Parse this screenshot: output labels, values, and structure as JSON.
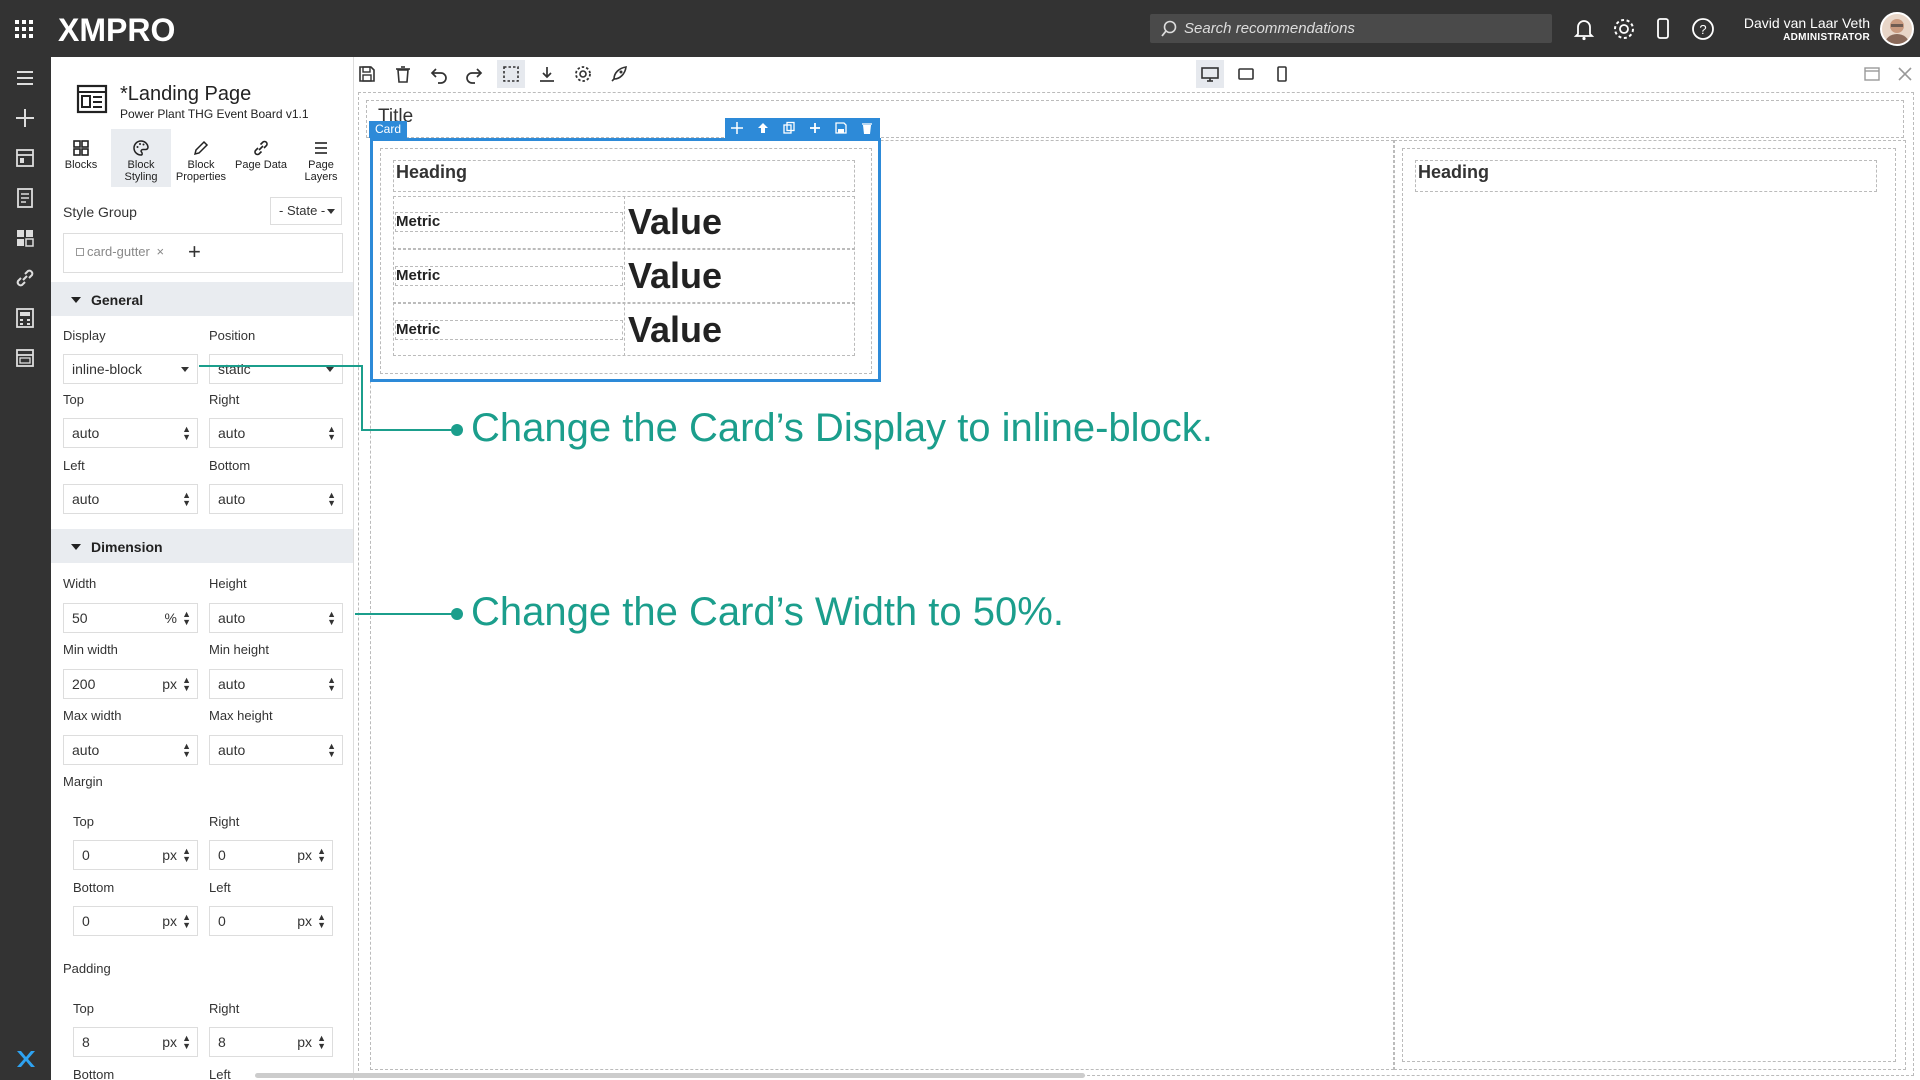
{
  "app": {
    "logo": "XMPRO",
    "search_placeholder": "Search recommendations",
    "user_name": "David van Laar Veth",
    "user_role": "ADMINISTRATOR"
  },
  "page": {
    "title": "*Landing Page",
    "subtitle": "Power Plant THG Event Board v1.1"
  },
  "tabs": [
    {
      "label": "Blocks"
    },
    {
      "label": "Block Styling"
    },
    {
      "label": "Block Properties"
    },
    {
      "label": "Page Data"
    },
    {
      "label": "Page Layers"
    }
  ],
  "style_group": {
    "label": "Style Group",
    "state": "- State -",
    "chip": "card-gutter"
  },
  "general": {
    "header": "General",
    "display_label": "Display",
    "display_value": "inline-block",
    "position_label": "Position",
    "position_value": "static",
    "top_label": "Top",
    "top_value": "auto",
    "right_label": "Right",
    "right_value": "auto",
    "left_label": "Left",
    "left_value": "auto",
    "bottom_label": "Bottom",
    "bottom_value": "auto"
  },
  "dimension": {
    "header": "Dimension",
    "width_label": "Width",
    "width_value": "50",
    "width_unit": "%",
    "height_label": "Height",
    "height_value": "auto",
    "min_width_label": "Min width",
    "min_width_value": "200",
    "min_width_unit": "px",
    "min_height_label": "Min height",
    "min_height_value": "auto",
    "max_width_label": "Max width",
    "max_width_value": "auto",
    "max_height_label": "Max height",
    "max_height_value": "auto"
  },
  "margin": {
    "label": "Margin",
    "top_label": "Top",
    "top_value": "0",
    "right_label": "Right",
    "right_value": "0",
    "bottom_label": "Bottom",
    "bottom_value": "0",
    "left_label": "Left",
    "left_value": "0",
    "unit": "px"
  },
  "padding": {
    "label": "Padding",
    "top_label": "Top",
    "top_value": "8",
    "right_label": "Right",
    "right_value": "8",
    "bottom_label": "Bottom",
    "left_label": "Left",
    "unit": "px"
  },
  "canvas": {
    "title": "Title",
    "card_tag": "Card",
    "heading": "Heading",
    "metric": "Metric",
    "value": "Value",
    "heading_right": "Heading"
  },
  "callouts": {
    "display": "Change the Card’s Display to inline-block.",
    "width": "Change the Card’s Width to 50%."
  },
  "colors": {
    "topbar": "#333333",
    "accent": "#2d8ad8",
    "callout": "#1b9e8c"
  }
}
